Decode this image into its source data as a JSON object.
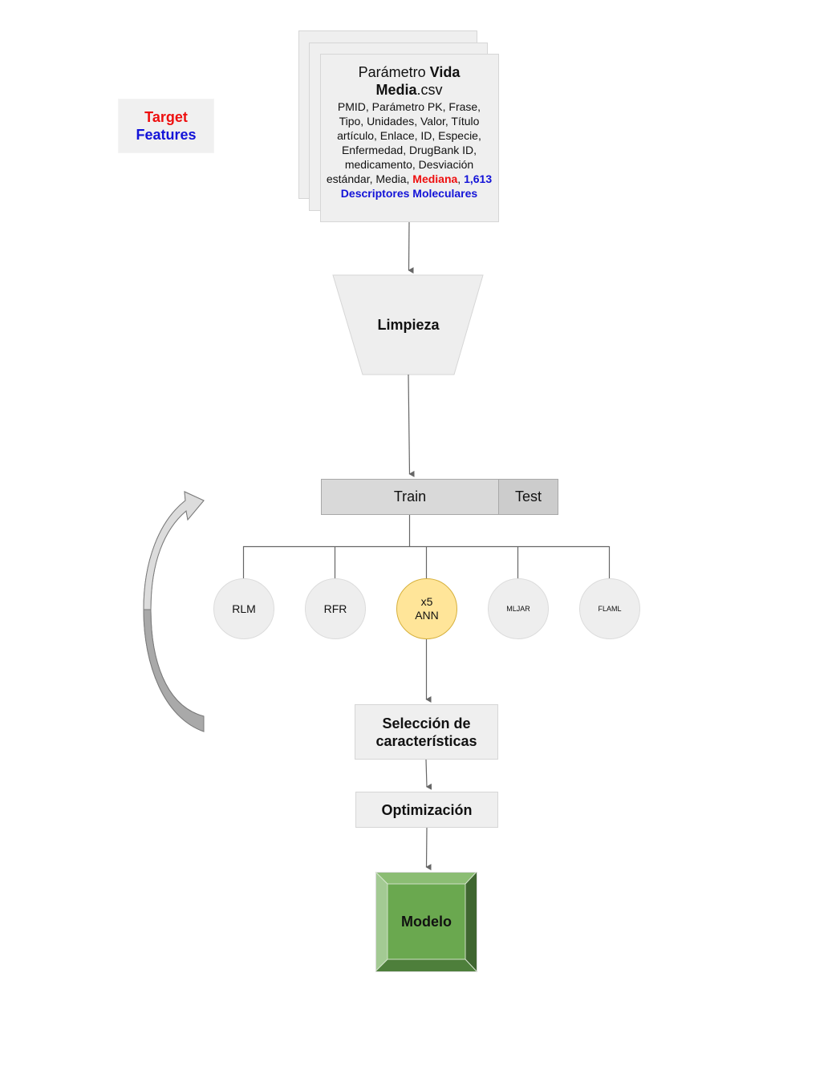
{
  "legend": {
    "target_label": "Target",
    "features_label": "Features",
    "colors": {
      "target": "#ee0f0f",
      "features": "#1313d8"
    }
  },
  "dataset": {
    "title_prefix": "Parámetro ",
    "title_bold_1": "Vida",
    "title_bold_2": "Media",
    "title_suffix": ".csv",
    "columns_plain": "PMID, Parámetro PK, Frase, Tipo, Unidades, Valor, Título artículo, Enlace, ID, Especie, Enfermedad, DrugBank ID, medicamento, Desviación estándar, Media, ",
    "target_column": "Mediana",
    "separator": ",",
    "features_text": "1,613 Descriptores Moleculares"
  },
  "steps": {
    "cleaning": "Limpieza",
    "split": {
      "train": "Train",
      "test": "Test"
    },
    "models": [
      {
        "id": "rlm",
        "label": "RLM"
      },
      {
        "id": "rfr",
        "label": "RFR"
      },
      {
        "id": "ann",
        "label_line1": "x5",
        "label_line2": "ANN",
        "highlighted": true
      },
      {
        "id": "mljar",
        "label": "MLJAR"
      },
      {
        "id": "flaml",
        "label": "FLAML"
      }
    ],
    "feature_selection": "Selección de características",
    "optimization": "Optimización",
    "model": "Modelo"
  },
  "colors": {
    "ann_fill": "#ffe599",
    "model_green": "#6aa84f"
  }
}
